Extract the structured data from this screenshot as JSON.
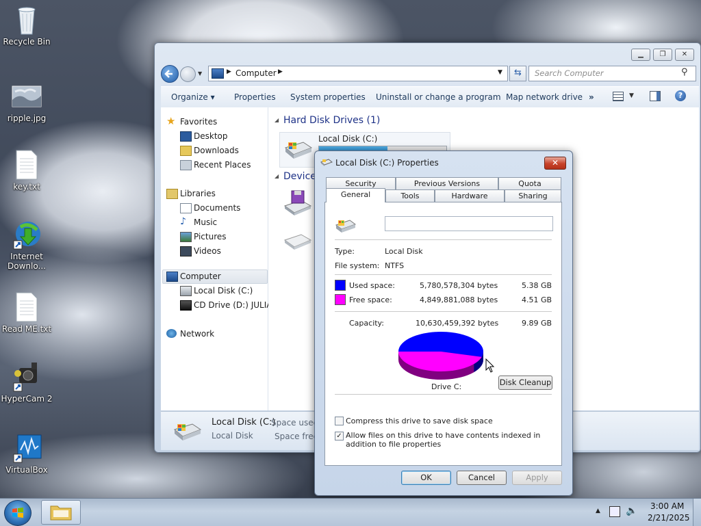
{
  "desktop": {
    "icons": [
      {
        "label": "Recycle Bin",
        "icon": "recycle-bin-icon"
      },
      {
        "label": "ripple.jpg",
        "icon": "image-file-icon"
      },
      {
        "label": "key.txt",
        "icon": "text-file-icon"
      },
      {
        "label": "Internet Downlo...",
        "icon": "internet-download-manager-icon"
      },
      {
        "label": "Read ME.txt",
        "icon": "text-file-icon"
      },
      {
        "label": "HyperCam 2",
        "icon": "hypercam-icon"
      },
      {
        "label": "VirtualBox",
        "icon": "virtualbox-icon"
      }
    ]
  },
  "explorer": {
    "address": {
      "crumb": "Computer"
    },
    "search_placeholder": "Search Computer",
    "toolbar": {
      "organize": "Organize",
      "properties": "Properties",
      "system_properties": "System properties",
      "uninstall": "Uninstall or change a program",
      "map_drive": "Map network drive",
      "more": "»"
    },
    "nav": {
      "favorites": "Favorites",
      "desktop": "Desktop",
      "downloads": "Downloads",
      "recent_places": "Recent Places",
      "libraries": "Libraries",
      "documents": "Documents",
      "music": "Music",
      "pictures": "Pictures",
      "videos": "Videos",
      "computer": "Computer",
      "local_disk": "Local Disk (C:)",
      "cd_drive": "CD Drive (D:) JULIA",
      "network": "Network"
    },
    "content": {
      "hdd_header": "Hard Disk Drives (1)",
      "drive_name": "Local Disk (C:)",
      "devices_header": "Device",
      "drive_used_fraction": 0.54
    },
    "details": {
      "name": "Local Disk (C:)",
      "type": "Local Disk",
      "space_used_label": "Space used:",
      "space_free_label": "Space free:"
    }
  },
  "dialog": {
    "title": "Local Disk (C:) Properties",
    "close": "✕",
    "tabs_row1": [
      "Security",
      "Previous Versions",
      "Quota"
    ],
    "tabs_row2": [
      "General",
      "Tools",
      "Hardware",
      "Sharing"
    ],
    "name_value": "",
    "type_label": "Type:",
    "type_value": "Local Disk",
    "fs_label": "File system:",
    "fs_value": "NTFS",
    "used_label": "Used space:",
    "used_bytes": "5,780,578,304 bytes",
    "used_gb": "5.38 GB",
    "free_label": "Free space:",
    "free_bytes": "4,849,881,088 bytes",
    "free_gb": "4.51 GB",
    "capacity_label": "Capacity:",
    "capacity_bytes": "10,630,459,392 bytes",
    "capacity_gb": "9.89 GB",
    "drive_label": "Drive C:",
    "cleanup": "Disk Cleanup",
    "compress_label": "Compress this drive to save disk space",
    "compress_checked": false,
    "index_label": "Allow files on this drive to have contents indexed in addition to file properties",
    "index_checked": true,
    "ok": "OK",
    "cancel": "Cancel",
    "apply": "Apply",
    "colors": {
      "used": "#0000ff",
      "free": "#ff00ff"
    }
  },
  "taskbar": {
    "time": "3:00 AM",
    "date": "2/21/2025"
  }
}
